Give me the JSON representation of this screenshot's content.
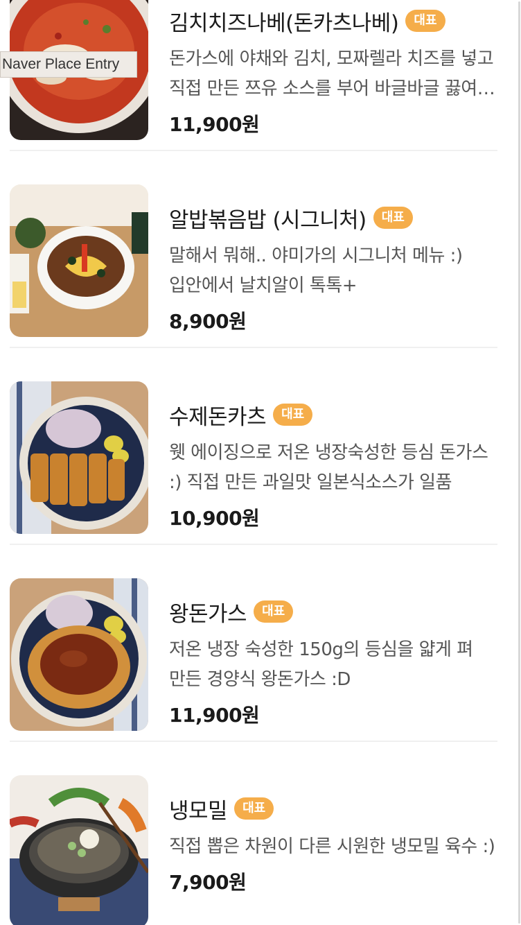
{
  "tooltip": {
    "text": "Naver Place Entry"
  },
  "menu": {
    "items": [
      {
        "name": "김치치즈나베(돈카츠나베)",
        "badge": "대표",
        "description": "돈가스에 야채와 김치, 모짜렐라 치즈를 넣고 직접 만든 쯔유 소스를 부어 바글바글 끓여낸 나베",
        "price": "11,900원",
        "image": "kimchi-cheese-nabe-photo"
      },
      {
        "name": "알밥볶음밥 (시그니처)",
        "badge": "대표",
        "description": "말해서 뭐해.. 야미가의 시그니처 메뉴 :) 입안에서 날치알이 톡톡+",
        "price": "8,900원",
        "image": "albap-fried-rice-photo"
      },
      {
        "name": "수제돈카츠",
        "badge": "대표",
        "description": "웻 에이징으로 저온 냉장숙성한 등심 돈가스 :) 직접 만든 과일맛 일본식소스가 일품",
        "price": "10,900원",
        "image": "handmade-tonkatsu-photo"
      },
      {
        "name": "왕돈가스",
        "badge": "대표",
        "description": "저온 냉장 숙성한 150g의 등심을 얇게 펴 만든 경양식 왕돈가스 :D",
        "price": "11,900원",
        "image": "wang-donkatsu-photo"
      },
      {
        "name": "냉모밀",
        "badge": "대표",
        "description": "직접 뽑은 차원이 다른 시원한 냉모밀 육수 :)",
        "price": "7,900원",
        "image": "naeng-momil-photo"
      }
    ]
  }
}
